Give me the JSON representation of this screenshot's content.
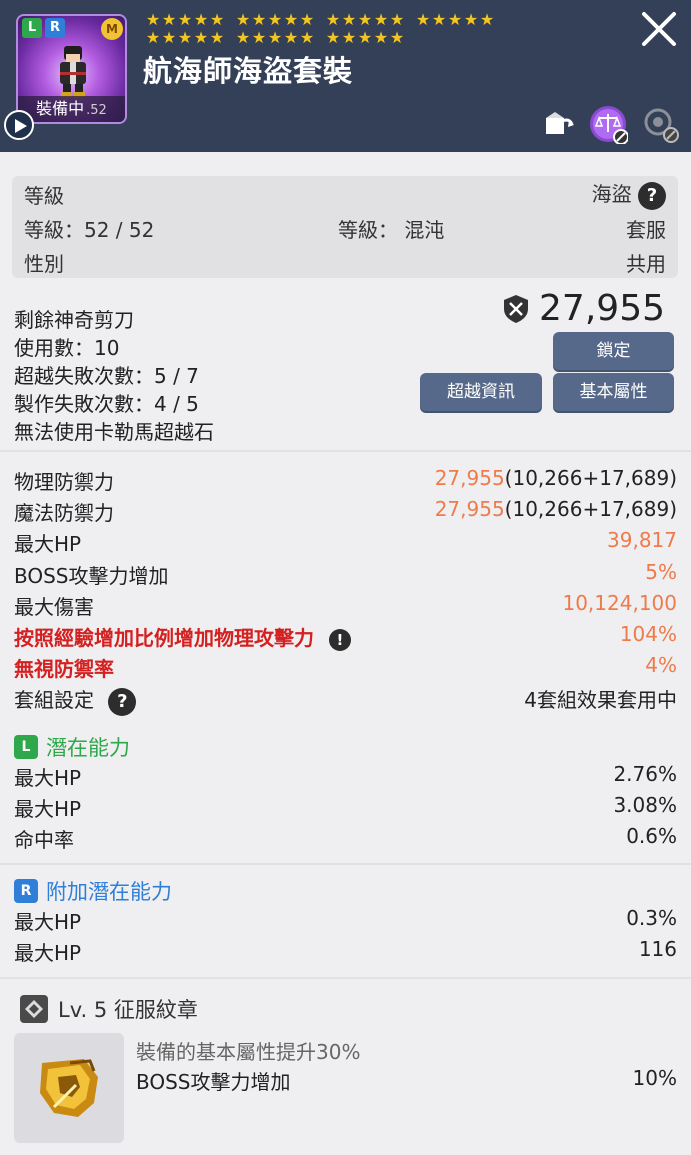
{
  "header": {
    "item_name": "航海師海盜套裝",
    "equipped_label": "裝備中",
    "item_level_badge": ".52",
    "badges": {
      "legendary": "L",
      "rare": "R",
      "mark": "M"
    },
    "star_rows": [
      [
        5,
        5,
        5,
        5
      ],
      [
        5,
        5,
        5
      ]
    ],
    "icons": [
      "play-icon",
      "close-icon",
      "transfer-icon",
      "scale-icon",
      "reset-icon"
    ]
  },
  "requirements": {
    "level_label": "等級",
    "job": "海盜",
    "level_value": "等級：52 / 52",
    "grade": "等級： 混沌",
    "category": "套服",
    "gender_label": "性別",
    "gender_value": "共用"
  },
  "upgrade": {
    "lines": [
      "剩餘神奇剪刀",
      "使用數：10",
      "超越失敗次數：5 / 7",
      "製作失敗次數：4 / 5",
      "無法使用卡勒馬超越石"
    ],
    "combat_power": "27,955",
    "buttons": {
      "lock": "鎖定",
      "transcend_info": "超越資訊",
      "base_stats": "基本屬性"
    }
  },
  "stats": [
    {
      "label": "物理防禦力",
      "value_main": "27,955",
      "value_sub": "(10,266+17,689)",
      "style": "normal"
    },
    {
      "label": "魔法防禦力",
      "value_main": "27,955",
      "value_sub": "(10,266+17,689)",
      "style": "normal"
    },
    {
      "label": "最大HP",
      "value_main": "39,817",
      "value_sub": "",
      "style": "normal"
    },
    {
      "label": "BOSS攻擊力增加",
      "value_main": "5%",
      "value_sub": "",
      "style": "normal"
    },
    {
      "label": "最大傷害",
      "value_main": "10,124,100",
      "value_sub": "",
      "style": "normal"
    },
    {
      "label": "按照經驗增加比例增加物理攻擊力",
      "value_main": "104%",
      "value_sub": "",
      "style": "red"
    },
    {
      "label": "無視防禦率",
      "value_main": "4%",
      "value_sub": "",
      "style": "red"
    }
  ],
  "set": {
    "label": "套組設定",
    "value": "4套組效果套用中"
  },
  "potential": {
    "title": "潛在能力",
    "badge": "L",
    "lines": [
      {
        "label": "最大HP",
        "value": "2.76%"
      },
      {
        "label": "最大HP",
        "value": "3.08%"
      },
      {
        "label": "命中率",
        "value": "0.6%"
      }
    ]
  },
  "additional_potential": {
    "title": "附加潛在能力",
    "badge": "R",
    "lines": [
      {
        "label": "最大HP",
        "value": "0.3%"
      },
      {
        "label": "最大HP",
        "value": "116"
      }
    ]
  },
  "emblem": {
    "title": "Lv. 5 征服紋章",
    "desc": "裝備的基本屬性提升30%",
    "stat_label": "BOSS攻擊力增加",
    "stat_value": "10%"
  },
  "colors": {
    "header_bg": "#344058",
    "orange": "#ef7a4a",
    "red": "#d42020",
    "green": "#2ea84a",
    "blue": "#2f7fd8",
    "button": "#56698a"
  }
}
